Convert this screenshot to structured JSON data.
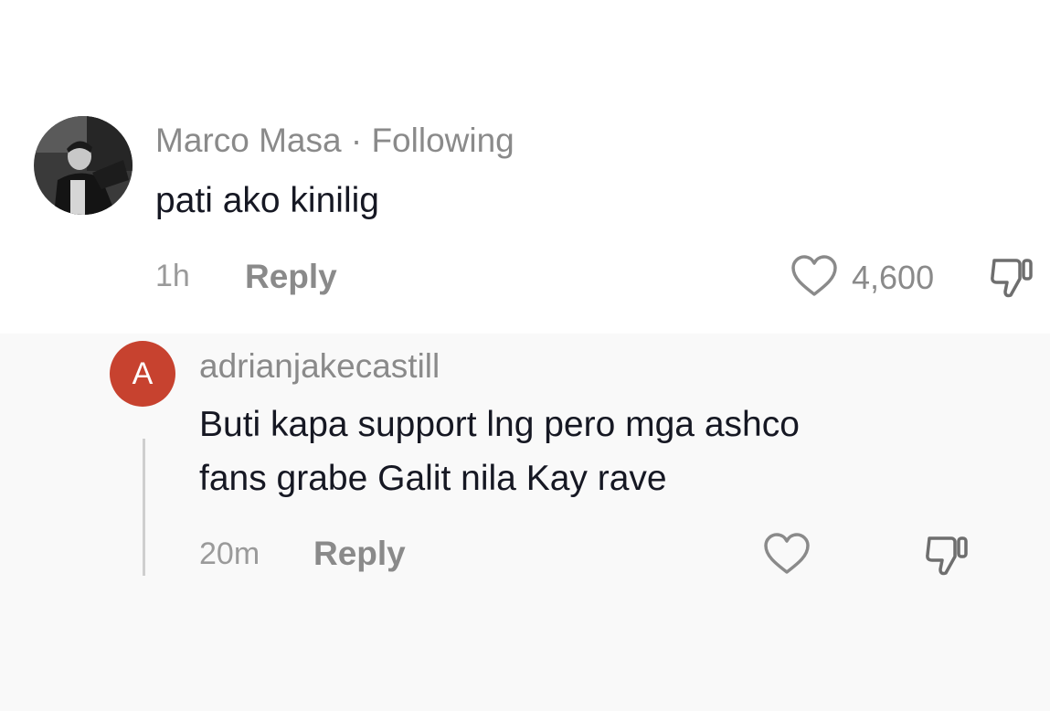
{
  "colors": {
    "avatar_letter_bg": "#c7422f",
    "muted_text": "#8a8a8a",
    "primary_text": "#161823",
    "reply_background": "#f9f9f9"
  },
  "comment": {
    "username": "Marco Masa",
    "separator": "·",
    "relation": "Following",
    "text": "pati ako kinilig",
    "time": "1h",
    "reply_label": "Reply",
    "like_count": "4,600",
    "avatar_icon": "profile-photo",
    "like_icon": "heart-outline-icon",
    "dislike_icon": "thumbs-down-icon"
  },
  "reply": {
    "avatar_letter": "A",
    "username": "adrianjakecastill",
    "text_line1": "Buti kapa support lng pero mga ashco",
    "text_line2": "fans grabe Galit nila Kay rave",
    "time": "20m",
    "reply_label": "Reply",
    "like_icon": "heart-outline-icon",
    "dislike_icon": "thumbs-down-icon"
  }
}
